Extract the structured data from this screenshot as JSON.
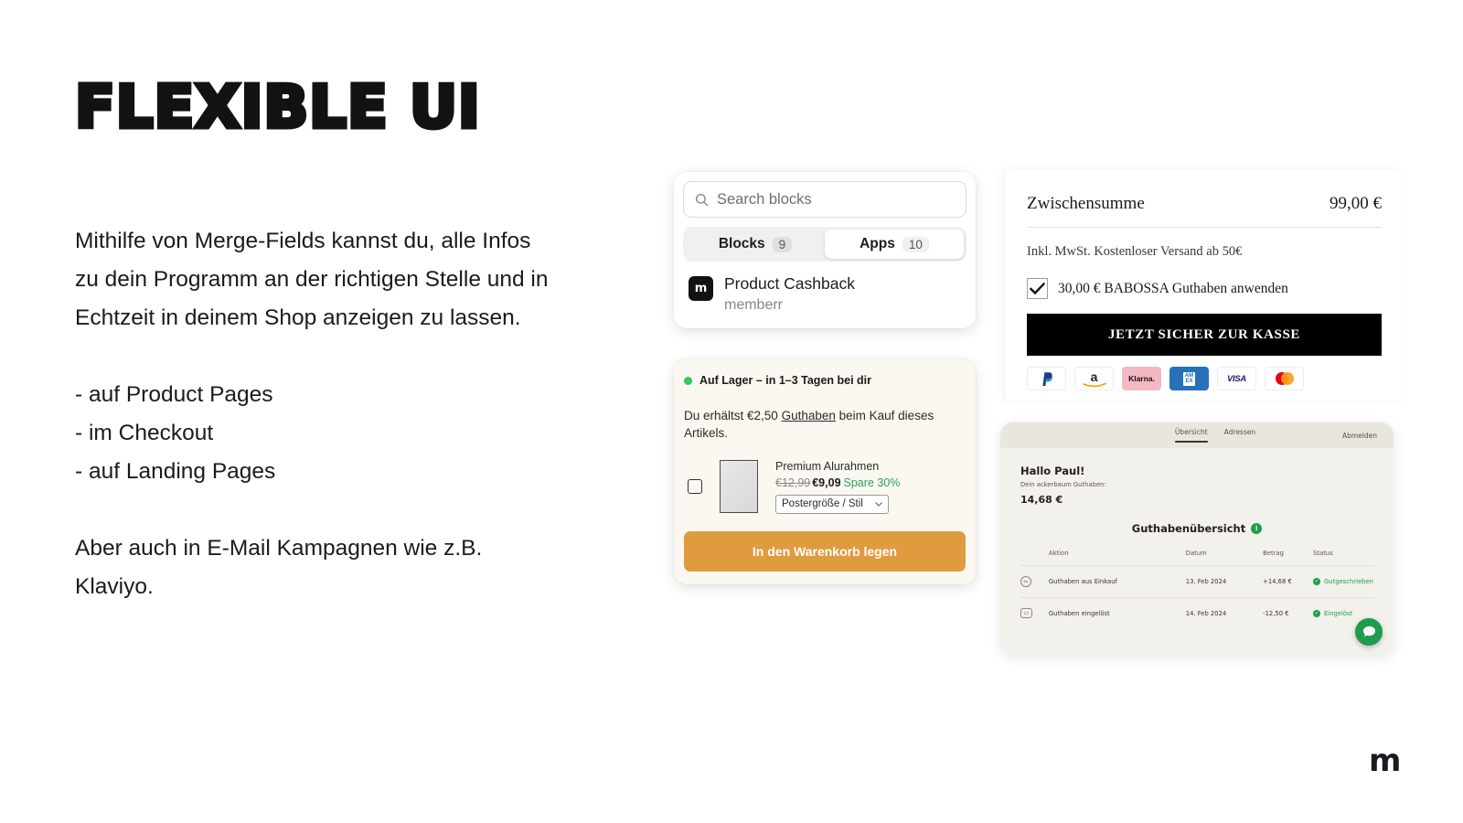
{
  "slide": {
    "headline": "FLEXIBLE UI",
    "paragraph_1": "Mithilfe von Merge-Fields kannst du, alle Infos zu dein Programm an der richtigen Stelle und in Echtzeit in deinem Shop anzeigen zu lassen.",
    "bullets": [
      "- auf Product Pages",
      "- im Checkout",
      "- auf Landing Pages"
    ],
    "paragraph_2": "Aber auch in E-Mail Kampagnen wie z.B. Klaviyo.",
    "footer_logo": "m"
  },
  "block_picker": {
    "search_placeholder": "Search blocks",
    "search_value": "",
    "tabs": [
      {
        "label": "Blocks",
        "count": "9",
        "active": false
      },
      {
        "label": "Apps",
        "count": "10",
        "active": true
      }
    ],
    "result": {
      "icon_letter": "m",
      "title": "Product Cashback",
      "subtitle": "memberr"
    }
  },
  "product_card": {
    "stock_status": "Auf Lager – in 1–3 Tagen bei dir",
    "cashback_prefix": "Du erhältst €2,50 ",
    "cashback_link": "Guthaben",
    "cashback_suffix": " beim Kauf dieses Artikels.",
    "item": {
      "name": "Premium Alurahmen",
      "price_old": "€12,99",
      "price_new": "€9,09",
      "discount": "Spare 30%",
      "variant_select": "Postergröße / Stil"
    },
    "cta_label": "In den Warenkorb legen",
    "accent_color": "#e09b3f",
    "background_color": "#faf8f1"
  },
  "checkout": {
    "subtotal_label": "Zwischensumme",
    "subtotal_value": "99,00 €",
    "tax_note": "Inkl. MwSt. Kostenloser Versand ab 50€",
    "credit_checkbox_label": "30,00 € BABOSSA Guthaben anwenden",
    "credit_checked": true,
    "checkout_button": "JETZT SICHER ZUR KASSE",
    "payment_methods": [
      {
        "name": "paypal-icon",
        "label": "P"
      },
      {
        "name": "amazon-pay-icon",
        "label": "a"
      },
      {
        "name": "klarna-icon",
        "label": "Klarna."
      },
      {
        "name": "amex-icon",
        "label": "AMEX"
      },
      {
        "name": "visa-icon",
        "label": "VISA"
      },
      {
        "name": "mastercard-icon",
        "label": ""
      }
    ]
  },
  "account_dashboard": {
    "tabs": [
      {
        "label": "Übersicht",
        "active": true
      },
      {
        "label": "Adressen",
        "active": false
      }
    ],
    "logout_label": "Abmelden",
    "greeting": "Hallo Paul!",
    "balance_label": "Dein ackerbaum Guthaben:",
    "balance_value": "14,68 €",
    "overview_title": "Guthabenübersicht",
    "table": {
      "columns": [
        "Aktion",
        "Datum",
        "Betrag",
        "Status"
      ],
      "rows": [
        {
          "icon": "scissors-icon",
          "action": "Guthaben aus Einkauf",
          "date": "13. Feb 2024",
          "amount": "+14,68 €",
          "status": "Gutgeschrieben"
        },
        {
          "icon": "card-icon",
          "action": "Guthaben eingelöst",
          "date": "14. Feb 2024",
          "amount": "-12,50 €",
          "status": "Eingelöst"
        }
      ]
    },
    "status_color": "#1f9d4d"
  }
}
